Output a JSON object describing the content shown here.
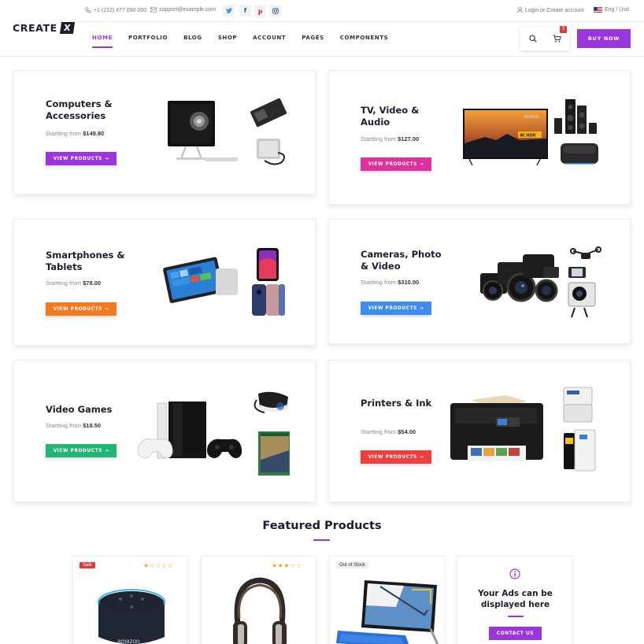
{
  "topbar": {
    "phone": "+1 (212) 477 690 000",
    "email": "support@example.com",
    "login": "Login or Create account",
    "language": "Eng / Usd"
  },
  "header": {
    "logo_text": "CREATE",
    "logo_mark": "X",
    "nav": [
      "HOME",
      "PORTFOLIO",
      "BLOG",
      "SHOP",
      "ACCOUNT",
      "PAGES",
      "COMPONENTS"
    ],
    "active_nav": "HOME",
    "cart_count": "3",
    "buy_now": "BUY NOW"
  },
  "categories": [
    {
      "title": "Computers & Accessories",
      "price_prefix": "Startting from",
      "price": "$149.80",
      "button": "VIEW PRODUCTS",
      "color": "#9b35dc"
    },
    {
      "title": "TV, Video & Audio",
      "price_prefix": "Startting from",
      "price": "$127.00",
      "button": "VIEW PRODUCTS",
      "color": "#e0309b"
    },
    {
      "title": "Smartphones & Tablets",
      "price_prefix": "Startting from",
      "price": "$78.00",
      "button": "VIEW PRODUCTS",
      "color": "#f47a1f"
    },
    {
      "title": "Cameras, Photo & Video",
      "price_prefix": "Startting from",
      "price": "$310.00",
      "button": "VIEW PRODUCTS",
      "color": "#3d8cf0"
    },
    {
      "title": "Video Games",
      "price_prefix": "Startting from",
      "price": "$18.50",
      "button": "VIEW PRODUCTS",
      "color": "#22b573"
    },
    {
      "title": "Printers & Ink",
      "price_prefix": "Startting from",
      "price": "$54.00",
      "button": "VIEW PRODUCTS",
      "color": "#ef3e3e"
    }
  ],
  "tv_brand": "BRAVIA",
  "tv_badge": "4K HDR",
  "featured": {
    "title": "Featured Products",
    "products": [
      {
        "tag": "Sale",
        "rating": 1,
        "brand_on_image": "amazon"
      },
      {
        "tag": "",
        "rating": 3
      },
      {
        "tag": "Out of Stock"
      }
    ],
    "ads": {
      "title": "Your Ads can be displayed here",
      "button": "CONTACT US"
    }
  },
  "colors": {
    "accent": "#9b35dc",
    "star": "#f0a025",
    "sale": "#e13a3a"
  }
}
